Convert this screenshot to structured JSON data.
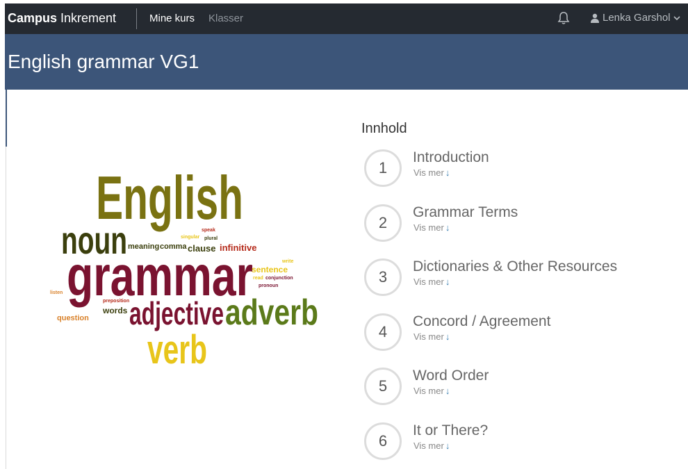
{
  "topbar": {
    "brand_bold": "Campus",
    "brand_light": " Inkrement",
    "nav": [
      {
        "label": "Mine kurs"
      },
      {
        "label": "Klasser"
      }
    ],
    "notifications_icon": "bell-icon",
    "user_name": "Lenka Garshol",
    "user_icon": "user-icon"
  },
  "header": {
    "title": "English grammar VG1"
  },
  "wordcloud": {
    "words": [
      "English",
      "noun",
      "grammar",
      "adjective",
      "adverb",
      "verb",
      "meaning",
      "comma",
      "clause",
      "infinitive",
      "sentence",
      "speak",
      "singular",
      "plural",
      "write",
      "read",
      "conjunction",
      "pronoun",
      "listen",
      "preposition",
      "words",
      "question"
    ],
    "colors": {
      "olive": "#7a7212",
      "dark": "#3b3f0d",
      "maroon": "#7a1330",
      "green": "#5b7a1a",
      "yellow": "#e8c51a",
      "orange": "#d9822b",
      "red": "#b52a1a"
    }
  },
  "contents": {
    "title": "Innhold",
    "more_label": "Vis mer",
    "items": [
      {
        "number": "1",
        "title": "Introduction"
      },
      {
        "number": "2",
        "title": "Grammar Terms"
      },
      {
        "number": "3",
        "title": "Dictionaries & Other Resources"
      },
      {
        "number": "4",
        "title": "Concord / Agreement"
      },
      {
        "number": "5",
        "title": "Word Order"
      },
      {
        "number": "6",
        "title": "It or There?"
      }
    ]
  }
}
